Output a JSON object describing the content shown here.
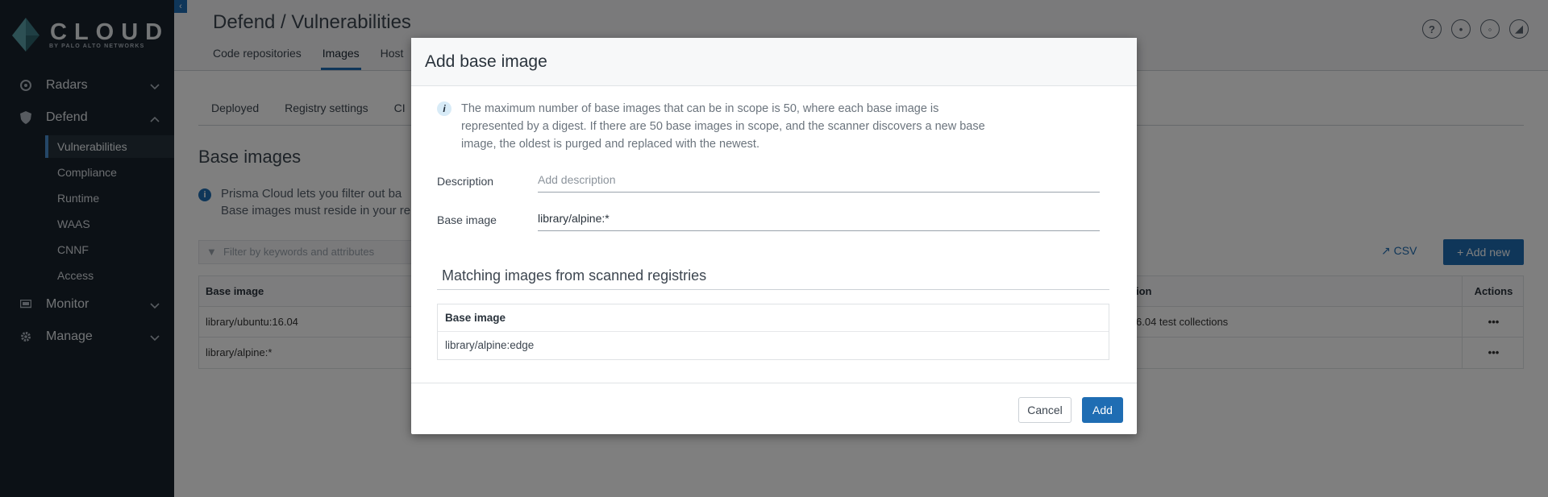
{
  "brand": {
    "name": "CLOUD",
    "tagline": "BY PALO ALTO NETWORKS"
  },
  "sidebar": {
    "items": [
      {
        "label": "Radars",
        "icon": "radar-icon"
      },
      {
        "label": "Defend",
        "icon": "shield-icon"
      },
      {
        "label": "Monitor",
        "icon": "monitor-icon"
      },
      {
        "label": "Manage",
        "icon": "gear-icon"
      }
    ],
    "defend_sub": [
      "Vulnerabilities",
      "Compliance",
      "Runtime",
      "WAAS",
      "CNNF",
      "Access"
    ]
  },
  "header": {
    "title": "Defend / Vulnerabilities",
    "tabs": [
      "Code repositories",
      "Images",
      "Host"
    ]
  },
  "subtabs": [
    "Deployed",
    "Registry settings",
    "CI"
  ],
  "section": {
    "title": "Base images",
    "info_1": "Prisma Cloud lets you filter out ba",
    "info_2": "Base images must reside in your re"
  },
  "toolbar": {
    "filter_placeholder": "Filter by keywords and attributes",
    "csv": "CSV",
    "add_new": "+ Add new"
  },
  "table": {
    "col_base": "Base image",
    "col_desc": "ion",
    "col_actions": "Actions",
    "rows": [
      {
        "image": "library/ubuntu:16.04",
        "desc": "6.04 test collections"
      },
      {
        "image": "library/alpine:*",
        "desc": ""
      }
    ]
  },
  "modal": {
    "title": "Add base image",
    "info": "The maximum number of base images that can be in scope is 50, where each base image is represented by a digest. If there are 50 base images in scope, and the scanner discovers a new base image, the oldest is purged and replaced with the newest.",
    "description_label": "Description",
    "description_placeholder": "Add description",
    "base_image_label": "Base image",
    "base_image_value": "library/alpine:*",
    "matching_title": "Matching images from scanned registries",
    "matching_header": "Base image",
    "matching_rows": [
      "library/alpine:edge"
    ],
    "cancel": "Cancel",
    "add": "Add"
  },
  "colors": {
    "accent": "#1f6db3",
    "sidebar_bg": "#19232d"
  }
}
